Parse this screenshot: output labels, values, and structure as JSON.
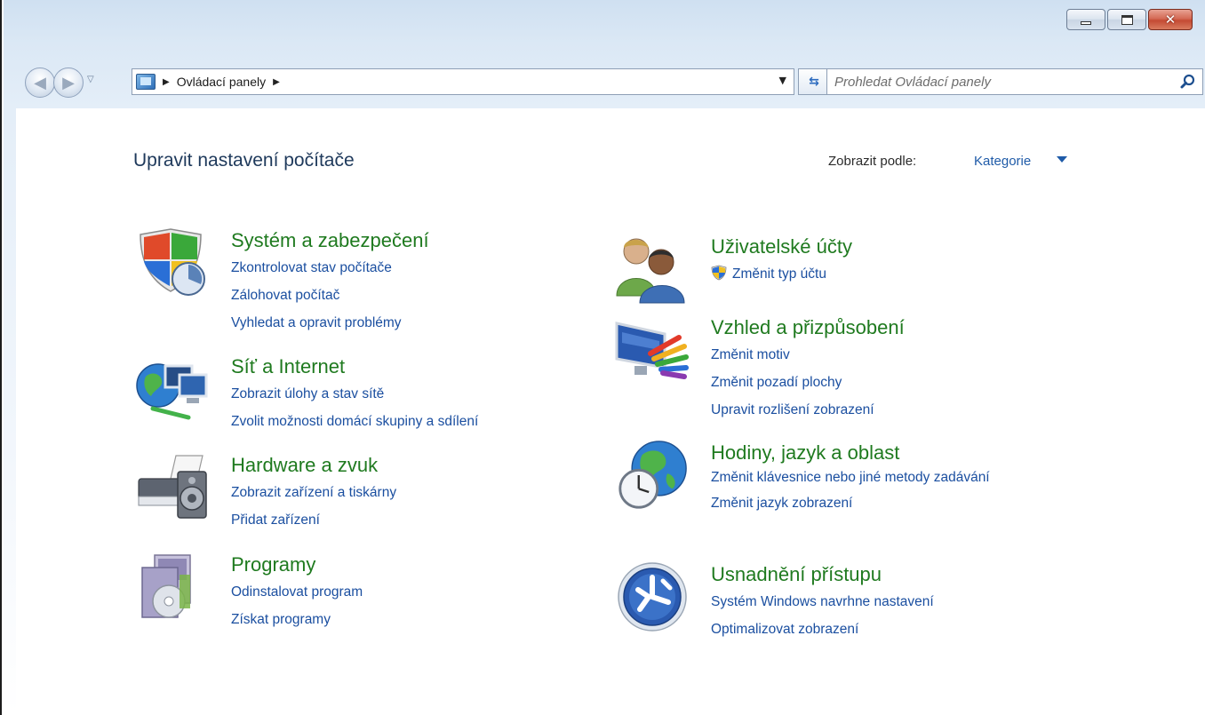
{
  "address_bar": {
    "crumbs": [
      "Ovládací panely"
    ]
  },
  "search": {
    "placeholder": "Prohledat Ovládací panely"
  },
  "header": {
    "title": "Upravit nastavení počítače",
    "view_by_label": "Zobrazit podle:",
    "view_by_value": "Kategorie"
  },
  "categories": [
    {
      "title": "Systém a zabezpečení",
      "icon": "security-shield-icon",
      "links": [
        "Zkontrolovat stav počítače",
        "Zálohovat počítač",
        "Vyhledat a opravit problémy"
      ]
    },
    {
      "title": "Síť a Internet",
      "icon": "network-globe-icon",
      "links": [
        "Zobrazit úlohy a stav sítě",
        "Zvolit možnosti domácí skupiny a sdílení"
      ]
    },
    {
      "title": "Hardware a zvuk",
      "icon": "printer-speaker-icon",
      "links": [
        "Zobrazit zařízení a tiskárny",
        "Přidat zařízení"
      ]
    },
    {
      "title": "Programy",
      "icon": "programs-disc-icon",
      "links": [
        "Odinstalovat program",
        "Získat programy"
      ]
    },
    {
      "title": "Uživatelské účty",
      "icon": "users-icon",
      "links": [
        "Změnit typ účtu"
      ]
    },
    {
      "title": "Vzhled a přizpůsobení",
      "icon": "monitor-palette-icon",
      "links": [
        "Změnit motiv",
        "Změnit pozadí plochy",
        "Upravit rozlišení zobrazení"
      ]
    },
    {
      "title": "Hodiny, jazyk a oblast",
      "icon": "clock-globe-icon",
      "links": [
        "Změnit klávesnice nebo jiné metody zadávání",
        "Změnit jazyk zobrazení"
      ]
    },
    {
      "title": "Usnadnění přístupu",
      "icon": "ease-of-access-icon",
      "links": [
        "Systém Windows navrhne nastavení",
        "Optimalizovat zobrazení"
      ]
    }
  ],
  "colors": {
    "category_title": "#1f7a1f",
    "link": "#1b4fa0",
    "page_title": "#1e395b"
  }
}
